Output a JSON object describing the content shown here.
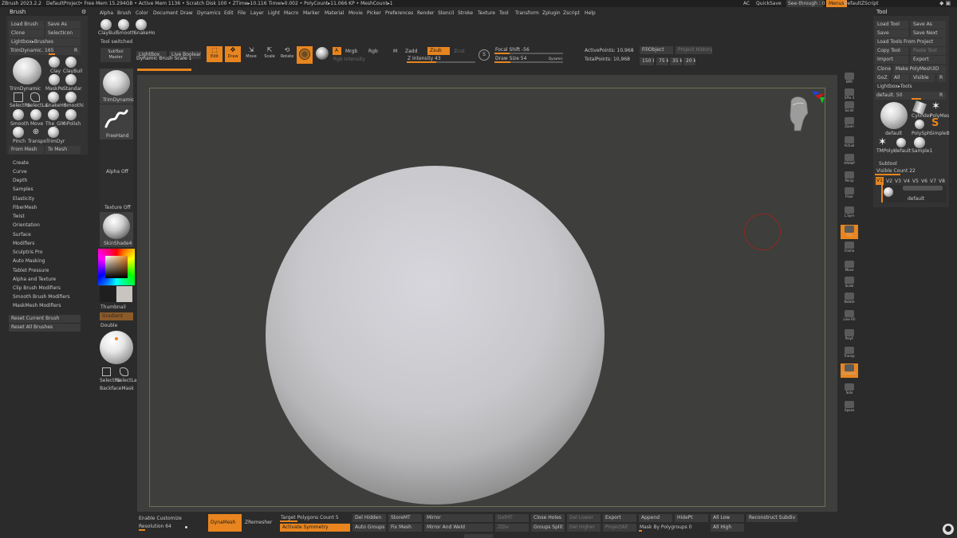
{
  "menubar": {
    "items": [
      "ZBrush 2023.2.2",
      "DefaultProject",
      "• Free Mem 15.294GB • Active Mem 1136 • Scratch Disk 100 • ZTime▸10.116 Timer▸0.002 • PolyCount▸11.066 KP • MeshCount▸1"
    ],
    "right": {
      "ac": "AC",
      "quicksave": "QuickSave",
      "seethrough": "See-through : 0",
      "menus": "Menus",
      "defaultzscript": "DefaultZScript"
    }
  },
  "main_menu": [
    "Alpha",
    "Brush",
    "Color",
    "Document",
    "Draw",
    "Dynamics",
    "Edit",
    "File",
    "Layer",
    "Light",
    "Macro",
    "Marker",
    "Material",
    "Movie",
    "Picker",
    "Preferences",
    "Render",
    "Stencil",
    "Stroke",
    "Texture",
    "Tool",
    "Transform",
    "Zplugin",
    "Zscript",
    "Help"
  ],
  "brush_palette": {
    "title": "Brush",
    "buttons": {
      "load": "Load Brush",
      "saveas": "Save As",
      "clone": "Clone",
      "selecticon": "SelectIcon",
      "lightbox": "Lightbox▸Brushes"
    },
    "current": "TrimDynamic. 165",
    "current_r": "R",
    "current_name": "TrimDynamic",
    "brushes": [
      "Clay",
      "ClayBuil",
      "MaskPe",
      "Standar",
      "SelectRe",
      "SelectLa",
      "SnakeHo",
      "Smoothi",
      "Smooth",
      "Move",
      "The_GlK",
      "hPolish",
      "Pinch",
      "Transpo",
      "TrimDyr"
    ],
    "from_mesh": "From Mesh",
    "to_mesh": "To Mesh",
    "sections": [
      "Create",
      "Curve",
      "Depth",
      "Samples",
      "Elasticity",
      "FiberMesh",
      "Twist",
      "Orientation",
      "Surface",
      "Modifiers",
      "Sculptris Pro",
      "Auto Masking",
      "Tablet Pressure",
      "Alpha and Texture",
      "Clip Brush Modifiers",
      "Smooth Brush Modifiers",
      "MaskMesh Modifiers"
    ],
    "reset_current": "Reset Current Brush",
    "reset_all": "Reset All Brushes"
  },
  "top_shelf": {
    "brush_names": [
      "ClayBuil",
      "Smooth",
      "SnakeHo"
    ],
    "tool_switched": "Tool switched",
    "subtool_master": "SubTool\nMaster",
    "lightbox": "LightBox",
    "live_boolean": "Live Boolean",
    "dynamic_brush_scale": "Dynamic Brush Scale 1",
    "edit": "Edit",
    "draw": "Draw",
    "move": "Move",
    "scale": "Scale",
    "rotate": "Rotate",
    "a": "A",
    "mrgb": "Mrgb",
    "rgb": "Rgb",
    "m": "M",
    "zadd": "Zadd",
    "zsub": "Zsub",
    "zcut": "Zcut",
    "rgb_intensity": "Rgb Intensity",
    "z_intensity": "Z Intensity 43",
    "focal_shift": "Focal Shift -56",
    "draw_size": "Draw Size 54",
    "dynamic": "Dynamic",
    "active_points": "ActivePoints: 10,968",
    "total_points": "TotalPoints: 10,968",
    "fill_object": "FillObject",
    "project_history": "Project History",
    "pts": [
      "150 k",
      "75 k",
      "35 k",
      "20 k"
    ]
  },
  "left_shelf": {
    "trimdynamic": "TrimDynamic",
    "freehand": "FreeHand",
    "alpha_off": "Alpha Off",
    "texture_off": "Texture Off",
    "skinshade": "SkinShade4",
    "thumbnail": "Thumbnail",
    "gradient_label": "Gradient",
    "double": "Double",
    "select_re": "SelectRe",
    "select_la": "SelectLa",
    "backface": "BackfaceMask"
  },
  "right_shelf": [
    "BPR",
    "SPix 3",
    "Scroll",
    "Zoom",
    "Actual",
    "AAHalf",
    "Persp",
    "Floor",
    "L.Sym",
    "Xyz",
    "Frame",
    "Move",
    "Scale",
    "Rotate",
    "Line Fill",
    "PolyF",
    "Transp",
    "Dynamic",
    "Solo",
    "Xpose"
  ],
  "tool_palette": {
    "title": "Tool",
    "buttons": {
      "load": "Load Tool",
      "saveas": "Save As",
      "save": "Save",
      "savenext": "Save Next",
      "load_project": "Load Tools From Project",
      "copy": "Copy Tool",
      "paste": "Paste Tool",
      "import": "Import",
      "export": "Export",
      "clone": "Clone",
      "make_polymesh": "Make PolyMesh3D",
      "goz": "GoZ",
      "all": "All",
      "visible": "Visible",
      "r": "R",
      "lightbox_tools": "Lightbox▸Tools"
    },
    "default_label": "default. 50",
    "default_r": "R",
    "tools": [
      "default",
      "Cylinder",
      "PolyMes",
      "PolySph",
      "SimpleB",
      "TMPolyI",
      "default",
      "Sample1"
    ],
    "subtool": "Subtool",
    "visible_count": "Visible Count 22",
    "versions": [
      "V1",
      "V2",
      "V3",
      "V4",
      "V5",
      "V6",
      "V7",
      "V8"
    ],
    "subtool_name": "default"
  },
  "bottom_bar": {
    "enable_customize": "Enable Customize",
    "resolution": "Resolution 64",
    "dynamesh": "DynaMesh",
    "zremesher": "ZRemesher",
    "target_polygons": "Target Polygons Count 5",
    "activate_symmetry": "Activate Symmetry",
    "del_hidden": "Del Hidden",
    "auto_groups": "Auto Groups",
    "storemt": "StoreMT",
    "fix_mesh": "Fix Mesh",
    "mirror": "Mirror",
    "mirror_weld": "Mirror And Weld",
    "delmt": "DelMT",
    "close_holes": "Close Holes",
    "groups_split": "Groups Split",
    "del_lower": "Del Lower",
    "del_higher": "Del Higher",
    "export": "Export",
    "projectall": "ProjectAll",
    "append": "Append",
    "mask_by_poly": "Mask By Polygroups 0",
    "hidept": "HidePt",
    "all_low": "All Low",
    "all_high": "All High",
    "reconstruct": "Reconstruct Subdiv",
    "ztp": "ZDiv"
  },
  "colors": {
    "accent": "#e8851f",
    "bg": "#2b2b2b",
    "panel": "#333333",
    "canvas": "#3d3d3b",
    "button": "#3c3c3c"
  }
}
